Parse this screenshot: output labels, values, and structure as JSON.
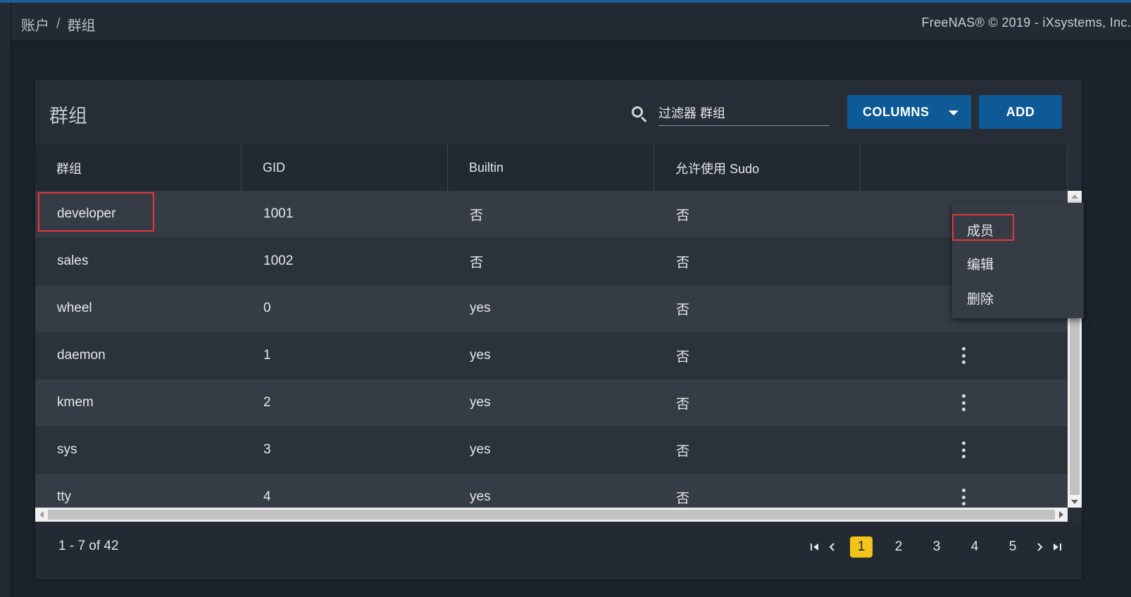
{
  "breadcrumb": {
    "parent": "账户",
    "separator": "/",
    "current": "群组"
  },
  "copyright": "FreeNAS® © 2019 - iXsystems, Inc.",
  "card": {
    "title": "群组",
    "search_placeholder": "过滤器 群组",
    "columns_label": "COLUMNS",
    "add_label": "ADD"
  },
  "table": {
    "headers": [
      "群组",
      "GID",
      "Builtin",
      "允许使用 Sudo"
    ],
    "rows": [
      {
        "name": "developer",
        "gid": "1001",
        "builtin": "否",
        "sudo": "否"
      },
      {
        "name": "sales",
        "gid": "1002",
        "builtin": "否",
        "sudo": "否"
      },
      {
        "name": "wheel",
        "gid": "0",
        "builtin": "yes",
        "sudo": "否"
      },
      {
        "name": "daemon",
        "gid": "1",
        "builtin": "yes",
        "sudo": "否"
      },
      {
        "name": "kmem",
        "gid": "2",
        "builtin": "yes",
        "sudo": "否"
      },
      {
        "name": "sys",
        "gid": "3",
        "builtin": "yes",
        "sudo": "否"
      },
      {
        "name": "tty",
        "gid": "4",
        "builtin": "yes",
        "sudo": "否"
      }
    ]
  },
  "menu": {
    "members": "成员",
    "edit": "编辑",
    "delete": "删除"
  },
  "pagination": {
    "range": "1 - 7 of 42",
    "pages": [
      "1",
      "2",
      "3",
      "4",
      "5"
    ],
    "current": "1"
  },
  "colors": {
    "accent": "#0d5a96",
    "active_page": "#f0c419",
    "highlight": "#e8343c"
  }
}
